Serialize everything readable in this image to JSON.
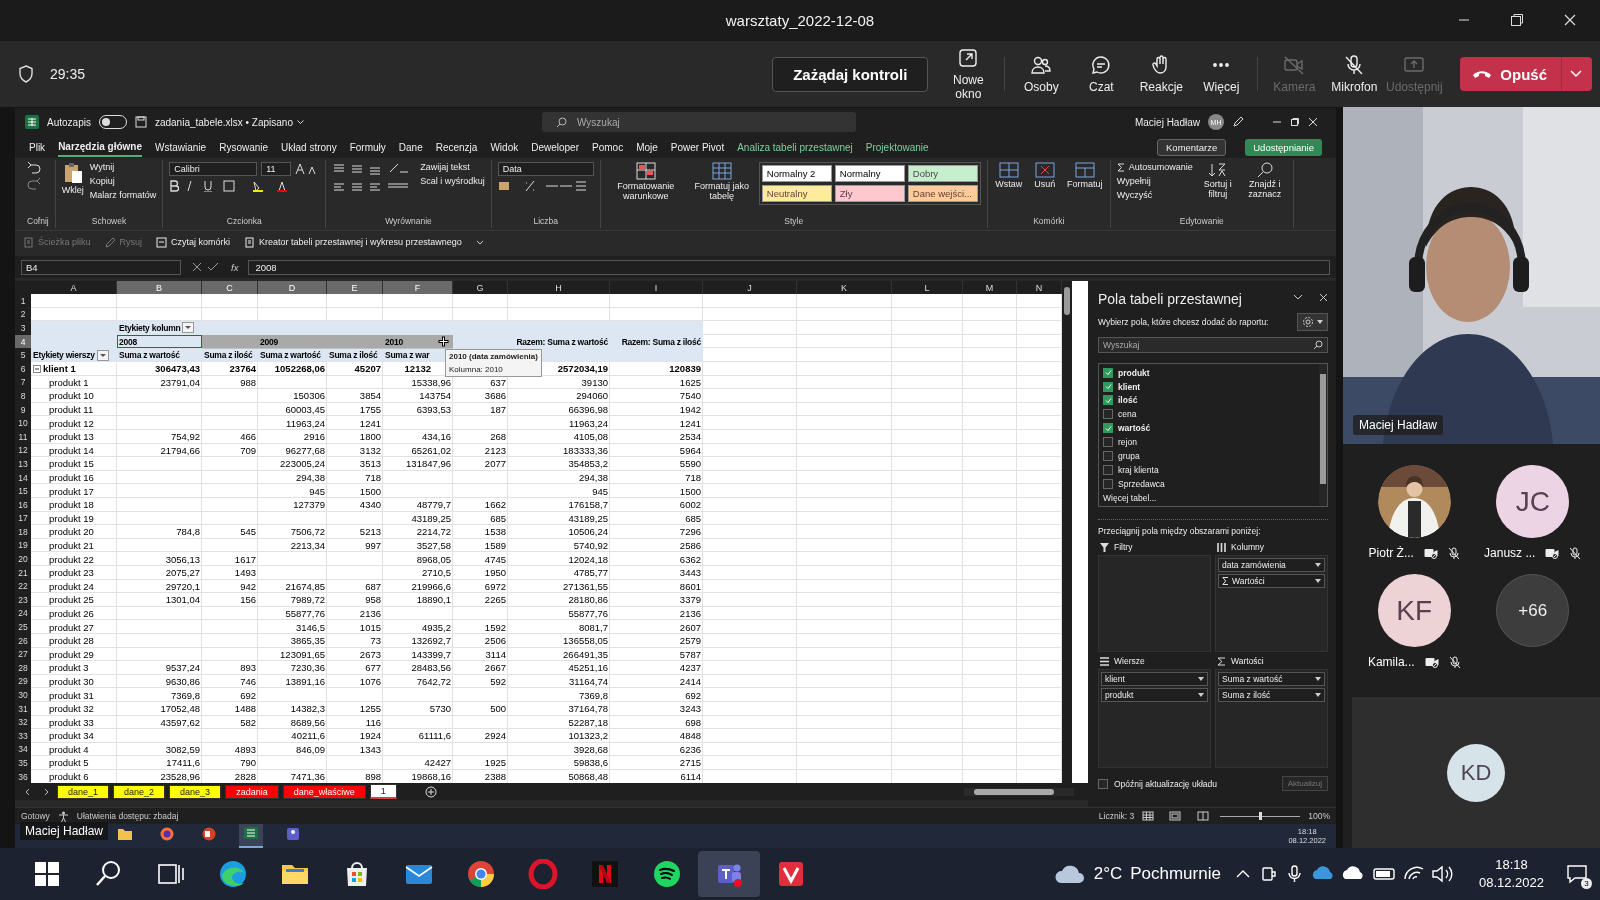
{
  "meeting": {
    "title": "warsztaty_2022-12-08",
    "timer": "29:35",
    "request_control": "Zażądaj kontroli",
    "tools": [
      {
        "label": "Nowe okno",
        "kind": "window",
        "disabled": false
      },
      {
        "label": "Osoby",
        "kind": "people",
        "disabled": false
      },
      {
        "label": "Czat",
        "kind": "chat",
        "disabled": false
      },
      {
        "label": "Reakcje",
        "kind": "hand",
        "disabled": false
      },
      {
        "label": "Więcej",
        "kind": "more",
        "disabled": false
      },
      {
        "label": "Kamera",
        "kind": "camera",
        "disabled": true
      },
      {
        "label": "Mikrofon",
        "kind": "mic",
        "disabled": false
      },
      {
        "label": "Udostępnij",
        "kind": "share",
        "disabled": true
      }
    ],
    "leave": "Opuść"
  },
  "excel": {
    "autosave": "Autozapis",
    "autosave_on": false,
    "file": "zadania_tabele.xlsx • Zapisano",
    "search_placeholder": "Wyszukaj",
    "user": "Maciej Hadław",
    "initials": "MH",
    "tabs": [
      {
        "label": "Plik",
        "selected": false,
        "contextual": false
      },
      {
        "label": "Narzędzia główne",
        "selected": true,
        "contextual": false
      },
      {
        "label": "Wstawianie",
        "selected": false,
        "contextual": false
      },
      {
        "label": "Rysowanie",
        "selected": false,
        "contextual": false
      },
      {
        "label": "Układ strony",
        "selected": false,
        "contextual": false
      },
      {
        "label": "Formuły",
        "selected": false,
        "contextual": false
      },
      {
        "label": "Dane",
        "selected": false,
        "contextual": false
      },
      {
        "label": "Recenzja",
        "selected": false,
        "contextual": false
      },
      {
        "label": "Widok",
        "selected": false,
        "contextual": false
      },
      {
        "label": "Deweloper",
        "selected": false,
        "contextual": false
      },
      {
        "label": "Pomoc",
        "selected": false,
        "contextual": false
      },
      {
        "label": "Moje",
        "selected": false,
        "contextual": false
      },
      {
        "label": "Power Pivot",
        "selected": false,
        "contextual": false
      },
      {
        "label": "Analiza tabeli przestawnej",
        "selected": false,
        "contextual": true
      },
      {
        "label": "Projektowanie",
        "selected": false,
        "contextual": true
      }
    ],
    "comments": "Komentarze",
    "share": "Udostępnianie",
    "ribbon": {
      "undo_label": "Cofnij",
      "clipboard": {
        "paste": "Wklej",
        "cut": "Wytnij",
        "copy": "Kopiuj",
        "painter": "Malarz formatów",
        "label": "Schowek"
      },
      "font": {
        "name": "Calibri",
        "size": "11",
        "label": "Czcionka"
      },
      "alignment": {
        "wrap": "Zawijaj tekst",
        "merge": "Scal i wyśrodkuj",
        "label": "Wyrównanie"
      },
      "number": {
        "format": "Data",
        "label": "Liczba"
      },
      "styles": {
        "conditional": "Formatowanie warunkowe",
        "as_table": "Formatuj jako tabelę",
        "label": "Style",
        "cells": [
          {
            "label": "Normalny 2",
            "color": "#ffffff"
          },
          {
            "label": "Normalny",
            "color": "#ffffff"
          },
          {
            "label": "Dobry",
            "color": "#c6efce"
          },
          {
            "label": "Neutralny",
            "color": "#ffeb9c"
          },
          {
            "label": "Zły",
            "color": "#ffc7ce"
          },
          {
            "label": "Dane wejści...",
            "color": "#ffcc99"
          }
        ]
      },
      "cells": {
        "insert": "Wstaw",
        "delete": "Usuń",
        "format": "Formatuj",
        "label": "Komórki"
      },
      "editing": {
        "autosum": "Autosumowanie",
        "fill": "Wypełnij",
        "clear": "Wyczyść",
        "sort": "Sortuj i filtruj",
        "find": "Znajdź i zaznacz",
        "label": "Edytowanie"
      }
    },
    "quick_bar": [
      {
        "label": "Ścieżka pliku",
        "kind": "path",
        "disabled": true
      },
      {
        "label": "Rysuj",
        "kind": "draw",
        "disabled": true
      },
      {
        "label": "Czytaj komórki",
        "kind": "read",
        "disabled": false
      },
      {
        "label": "Kreator tabeli przestawnej i wykresu przestawnego",
        "kind": "wizard",
        "disabled": false
      }
    ],
    "formula_bar": {
      "name_box": "B4",
      "fx": "fx",
      "value": "2008"
    },
    "columns": [
      {
        "label": "A",
        "selected": false
      },
      {
        "label": "B",
        "selected": true
      },
      {
        "label": "C",
        "selected": true
      },
      {
        "label": "D",
        "selected": true
      },
      {
        "label": "E",
        "selected": true
      },
      {
        "label": "F",
        "selected": true
      },
      {
        "label": "G",
        "selected": false
      },
      {
        "label": "H",
        "selected": false
      },
      {
        "label": "I",
        "selected": false
      },
      {
        "label": "J",
        "selected": false
      },
      {
        "label": "K",
        "selected": false
      },
      {
        "label": "L",
        "selected": false
      },
      {
        "label": "M",
        "selected": false
      },
      {
        "label": "N",
        "selected": false
      }
    ],
    "rows": [
      {
        "n": "1",
        "selected": false,
        "kind": "blank"
      },
      {
        "n": "2",
        "selected": false,
        "kind": "blank"
      },
      {
        "n": "3",
        "selected": false,
        "kind": "col_label",
        "cells": [
          null,
          "Etykiety kolumn",
          null,
          null,
          null,
          null,
          null,
          null,
          null
        ]
      },
      {
        "n": "4",
        "selected": true,
        "kind": "years",
        "cells": [
          null,
          "2008",
          null,
          "2009",
          null,
          "2010",
          null,
          "Razem: Suma z wartość",
          "Razem: Suma z ilość"
        ]
      },
      {
        "n": "5",
        "selected": false,
        "kind": "measures",
        "cells": [
          "Etykiety wierszy",
          "Suma z wartość",
          "Suma z ilość",
          "Suma z wartość",
          "Suma z ilość",
          "Suma z war",
          null,
          null,
          null
        ]
      },
      {
        "n": "6",
        "selected": false,
        "kind": "group",
        "cells": [
          "klient 1",
          "306473,43",
          "23764",
          "1052268,06",
          "45207",
          "12132",
          null,
          "2572034,19",
          "120839"
        ]
      },
      {
        "n": "7",
        "selected": false,
        "kind": "item",
        "cells": [
          "produkt 1",
          "23791,04",
          "988",
          null,
          null,
          "15338,96",
          "637",
          "39130",
          "1625"
        ]
      },
      {
        "n": "8",
        "selected": false,
        "kind": "item",
        "cells": [
          "produkt 10",
          null,
          null,
          "150306",
          "3854",
          "143754",
          "3686",
          "294060",
          "7540"
        ]
      },
      {
        "n": "9",
        "selected": false,
        "kind": "item",
        "cells": [
          "produkt 11",
          null,
          null,
          "60003,45",
          "1755",
          "6393,53",
          "187",
          "66396,98",
          "1942"
        ]
      },
      {
        "n": "10",
        "selected": false,
        "kind": "item",
        "cells": [
          "produkt 12",
          null,
          null,
          "11963,24",
          "1241",
          null,
          null,
          "11963,24",
          "1241"
        ]
      },
      {
        "n": "11",
        "selected": false,
        "kind": "item",
        "cells": [
          "produkt 13",
          "754,92",
          "466",
          "2916",
          "1800",
          "434,16",
          "268",
          "4105,08",
          "2534"
        ]
      },
      {
        "n": "12",
        "selected": false,
        "kind": "item",
        "cells": [
          "produkt 14",
          "21794,66",
          "709",
          "96277,68",
          "3132",
          "65261,02",
          "2123",
          "183333,36",
          "5964"
        ]
      },
      {
        "n": "13",
        "selected": false,
        "kind": "item",
        "cells": [
          "produkt 15",
          null,
          null,
          "223005,24",
          "3513",
          "131847,96",
          "2077",
          "354853,2",
          "5590"
        ]
      },
      {
        "n": "14",
        "selected": false,
        "kind": "item",
        "cells": [
          "produkt 16",
          null,
          null,
          "294,38",
          "718",
          null,
          null,
          "294,38",
          "718"
        ]
      },
      {
        "n": "15",
        "selected": false,
        "kind": "item",
        "cells": [
          "produkt 17",
          null,
          null,
          "945",
          "1500",
          null,
          null,
          "945",
          "1500"
        ]
      },
      {
        "n": "16",
        "selected": false,
        "kind": "item",
        "cells": [
          "produkt 18",
          null,
          null,
          "127379",
          "4340",
          "48779,7",
          "1662",
          "176158,7",
          "6002"
        ]
      },
      {
        "n": "17",
        "selected": false,
        "kind": "item",
        "cells": [
          "produkt 19",
          null,
          null,
          null,
          null,
          "43189,25",
          "685",
          "43189,25",
          "685"
        ]
      },
      {
        "n": "18",
        "selected": false,
        "kind": "item",
        "cells": [
          "produkt 20",
          "784,8",
          "545",
          "7506,72",
          "5213",
          "2214,72",
          "1538",
          "10506,24",
          "7296"
        ]
      },
      {
        "n": "19",
        "selected": false,
        "kind": "item",
        "cells": [
          "produkt 21",
          null,
          null,
          "2213,34",
          "997",
          "3527,58",
          "1589",
          "5740,92",
          "2586"
        ]
      },
      {
        "n": "20",
        "selected": false,
        "kind": "item",
        "cells": [
          "produkt 22",
          "3056,13",
          "1617",
          null,
          null,
          "8968,05",
          "4745",
          "12024,18",
          "6362"
        ]
      },
      {
        "n": "21",
        "selected": false,
        "kind": "item",
        "cells": [
          "produkt 23",
          "2075,27",
          "1493",
          null,
          null,
          "2710,5",
          "1950",
          "4785,77",
          "3443"
        ]
      },
      {
        "n": "22",
        "selected": false,
        "kind": "item",
        "cells": [
          "produkt 24",
          "29720,1",
          "942",
          "21674,85",
          "687",
          "219966,6",
          "6972",
          "271361,55",
          "8601"
        ]
      },
      {
        "n": "23",
        "selected": false,
        "kind": "item",
        "cells": [
          "produkt 25",
          "1301,04",
          "156",
          "7989,72",
          "958",
          "18890,1",
          "2265",
          "28180,86",
          "3379"
        ]
      },
      {
        "n": "24",
        "selected": false,
        "kind": "item",
        "cells": [
          "produkt 26",
          null,
          null,
          "55877,76",
          "2136",
          null,
          null,
          "55877,76",
          "2136"
        ]
      },
      {
        "n": "25",
        "selected": false,
        "kind": "item",
        "cells": [
          "produkt 27",
          null,
          null,
          "3146,5",
          "1015",
          "4935,2",
          "1592",
          "8081,7",
          "2607"
        ]
      },
      {
        "n": "26",
        "selected": false,
        "kind": "item",
        "cells": [
          "produkt 28",
          null,
          null,
          "3865,35",
          "73",
          "132692,7",
          "2506",
          "136558,05",
          "2579"
        ]
      },
      {
        "n": "27",
        "selected": false,
        "kind": "item",
        "cells": [
          "produkt 29",
          null,
          null,
          "123091,65",
          "2673",
          "143399,7",
          "3114",
          "266491,35",
          "5787"
        ]
      },
      {
        "n": "28",
        "selected": false,
        "kind": "item",
        "cells": [
          "produkt 3",
          "9537,24",
          "893",
          "7230,36",
          "677",
          "28483,56",
          "2667",
          "45251,16",
          "4237"
        ]
      },
      {
        "n": "29",
        "selected": false,
        "kind": "item",
        "cells": [
          "produkt 30",
          "9630,86",
          "746",
          "13891,16",
          "1076",
          "7642,72",
          "592",
          "31164,74",
          "2414"
        ]
      },
      {
        "n": "30",
        "selected": false,
        "kind": "item",
        "cells": [
          "produkt 31",
          "7369,8",
          "692",
          null,
          null,
          null,
          null,
          "7369,8",
          "692"
        ]
      },
      {
        "n": "31",
        "selected": false,
        "kind": "item",
        "cells": [
          "produkt 32",
          "17052,48",
          "1488",
          "14382,3",
          "1255",
          "5730",
          "500",
          "37164,78",
          "3243"
        ]
      },
      {
        "n": "32",
        "selected": false,
        "kind": "item",
        "cells": [
          "produkt 33",
          "43597,62",
          "582",
          "8689,56",
          "116",
          null,
          null,
          "52287,18",
          "698"
        ]
      },
      {
        "n": "33",
        "selected": false,
        "kind": "item",
        "cells": [
          "produkt 34",
          null,
          null,
          "40211,6",
          "1924",
          "61111,6",
          "2924",
          "101323,2",
          "4848"
        ]
      },
      {
        "n": "34",
        "selected": false,
        "kind": "item",
        "cells": [
          "produkt 4",
          "3082,59",
          "4893",
          "846,09",
          "1343",
          null,
          null,
          "3928,68",
          "6236"
        ]
      },
      {
        "n": "35",
        "selected": false,
        "kind": "item",
        "cells": [
          "produkt 5",
          "17411,6",
          "790",
          null,
          null,
          "42427",
          "1925",
          "59838,6",
          "2715"
        ]
      },
      {
        "n": "36",
        "selected": false,
        "kind": "item",
        "cells": [
          "produkt 6",
          "23528,96",
          "2828",
          "7471,36",
          "898",
          "19868,16",
          "2388",
          "50868,48",
          "6114"
        ]
      }
    ],
    "tooltip": {
      "title": "2010 (data zamówienia)",
      "detail": "Kolumna: 2010"
    },
    "sheet_tabs": [
      {
        "label": "dane_1",
        "color": "#ffff00",
        "selected": false
      },
      {
        "label": "dane_2",
        "color": "#ffff00",
        "selected": false
      },
      {
        "label": "dane_3",
        "color": "#ffff00",
        "selected": false
      },
      {
        "label": "zadania",
        "color": "#ff0000",
        "selected": false
      },
      {
        "label": "dane_właściwe",
        "color": "#ff0000",
        "selected": false
      },
      {
        "label": "1",
        "color": "#ffffff",
        "selected": true
      }
    ],
    "status": {
      "ready": "Gotowy",
      "accessibility": "Ułatwienia dostępu: zbadaj",
      "count": "Licznik: 3",
      "zoom": "100%",
      "level": 0.5
    }
  },
  "pivot_panel": {
    "title": "Pola tabeli przestawnej",
    "hint": "Wybierz pola, które chcesz dodać do raportu:",
    "search_placeholder": "Wyszukaj",
    "fields": [
      {
        "label": "produkt",
        "checked": true
      },
      {
        "label": "klient",
        "checked": true
      },
      {
        "label": "ilość",
        "checked": true
      },
      {
        "label": "cena",
        "checked": false
      },
      {
        "label": "wartość",
        "checked": true
      },
      {
        "label": "rejon",
        "checked": false
      },
      {
        "label": "grupa",
        "checked": false
      },
      {
        "label": "kraj klienta",
        "checked": false
      },
      {
        "label": "Sprzedawca",
        "checked": false
      }
    ],
    "more_tables": "Więcej tabel...",
    "drag_hint": "Przeciągnij pola między obszarami poniżej:",
    "areas": [
      {
        "title": "Filtry",
        "kind": "filter"
      },
      {
        "title": "Kolumny",
        "kind": "columns",
        "items": [
          {
            "label": "data zamówienia",
            "sigma": false
          },
          {
            "label": "Wartości",
            "sigma": true
          }
        ]
      },
      {
        "title": "Wiersze",
        "kind": "rows",
        "items": [
          {
            "label": "klient",
            "sigma": false
          },
          {
            "label": "produkt",
            "sigma": false
          }
        ]
      },
      {
        "title": "Wartości",
        "kind": "values",
        "items": [
          {
            "label": "Suma z wartość",
            "sigma": false
          },
          {
            "label": "Suma z ilość",
            "sigma": false
          }
        ]
      }
    ],
    "defer": "Opóźnij aktualizację układu",
    "defer_checked": false,
    "update": "Aktualizuj"
  },
  "share_overlay": {
    "presenter": "Maciej Hadław"
  },
  "remote_taskbar": {
    "apps": [
      {
        "kind": "folder",
        "active": false
      },
      {
        "kind": "firefox",
        "active": false
      },
      {
        "kind": "slides",
        "active": false
      },
      {
        "kind": "sheet",
        "active": true
      },
      {
        "kind": "teams",
        "active": false
      }
    ],
    "time": "18:18",
    "date": "08.12.2022"
  },
  "video": {
    "name": "Maciej Hadław"
  },
  "participants": [
    {
      "name": "Piotr Ż...",
      "camera_off": true,
      "muted": true
    },
    {
      "name": "Janusz ...",
      "kind": "initials",
      "initials": "JC",
      "color": "#ecd4e4",
      "camera_off": true,
      "muted": true
    },
    {
      "name": "Kamila...",
      "kind": "initials",
      "initials": "KF",
      "color": "#eed3d6",
      "camera_off": true,
      "muted": true
    }
  ],
  "overflow": "+66",
  "spotlight": {
    "initials": "KD",
    "color": "#d6e4ea"
  },
  "taskbar": {
    "apps": [
      {
        "kind": "start",
        "active": false
      },
      {
        "kind": "search",
        "active": false
      },
      {
        "kind": "taskview",
        "active": false
      },
      {
        "kind": "edge",
        "active": false
      },
      {
        "kind": "explorer",
        "active": false
      },
      {
        "kind": "store",
        "active": false
      },
      {
        "kind": "mail",
        "active": false
      },
      {
        "kind": "chrome",
        "active": false
      },
      {
        "kind": "opera",
        "active": false
      },
      {
        "kind": "netflix",
        "active": false
      },
      {
        "kind": "spotify",
        "active": false
      },
      {
        "kind": "teams",
        "active": true
      },
      {
        "kind": "vivaldi",
        "active": false
      }
    ],
    "temperature": "2°C",
    "weather": "Pochmurnie",
    "time": "18:18",
    "date": "08.12.2022",
    "notifications": "3"
  }
}
